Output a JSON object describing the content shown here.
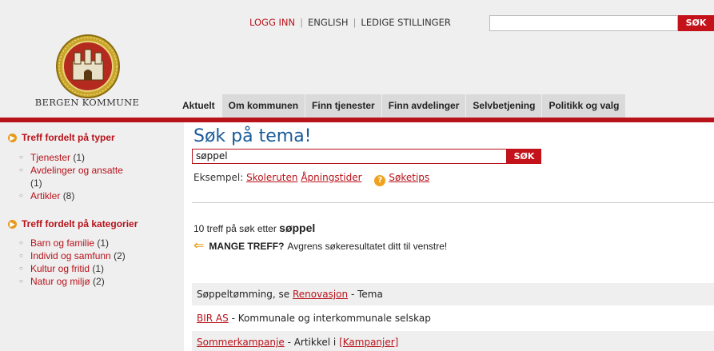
{
  "header": {
    "logo_text": "BERGEN KOMMUNE",
    "topnav": {
      "login": "LOGG INN",
      "english": "ENGLISH",
      "jobs": "LEDIGE STILLINGER",
      "separator": "|"
    },
    "top_search": {
      "value": "",
      "button_label": "SØK"
    }
  },
  "mainnav": {
    "items": [
      "Aktuelt",
      "Om kommunen",
      "Finn tjenester",
      "Finn avdelinger",
      "Selvbetjening",
      "Politikk og valg"
    ]
  },
  "sidebar": {
    "types_heading": "Treff fordelt på typer",
    "types": [
      {
        "label": "Tjenester",
        "count": "(1)"
      },
      {
        "label": "Avdelinger og ansatte",
        "count": "(1)"
      },
      {
        "label": "Artikler",
        "count": "(8)"
      }
    ],
    "categories_heading": "Treff fordelt på kategorier",
    "categories": [
      {
        "label": "Barn og familie",
        "count": "(1)"
      },
      {
        "label": "Individ og samfunn",
        "count": "(2)"
      },
      {
        "label": "Kultur og fritid",
        "count": "(1)"
      },
      {
        "label": "Natur og miljø",
        "count": "(2)"
      }
    ]
  },
  "main": {
    "title": "Søk på tema!",
    "search": {
      "value": "søppel",
      "button_label": "SØK"
    },
    "examples": {
      "prefix": "Eksempel:",
      "links": [
        "Skoleruten",
        "Åpningstider"
      ],
      "tips": "Søketips"
    },
    "summary": {
      "text": "10 treff på søk etter",
      "term": "søppel"
    },
    "many_hits": {
      "bold": "MANGE TREFF?",
      "text": "Avgrens søkeresultatet ditt til venstre!"
    },
    "results": [
      {
        "pre": "Søppeltømming, se",
        "link": "Renovasjon",
        "post": "- Tema",
        "extra": ""
      },
      {
        "pre": "",
        "link": "BIR AS",
        "post": "- Kommunale og interkommunale selskap",
        "extra": ""
      },
      {
        "pre": "",
        "link": "Sommerkampanje",
        "post": "- Artikkel i",
        "extra": "[Kampanjer]"
      }
    ]
  },
  "colors": {
    "brand_red": "#b8121a",
    "accent_orange": "#e79a1c",
    "title_blue": "#1b5c9a"
  }
}
